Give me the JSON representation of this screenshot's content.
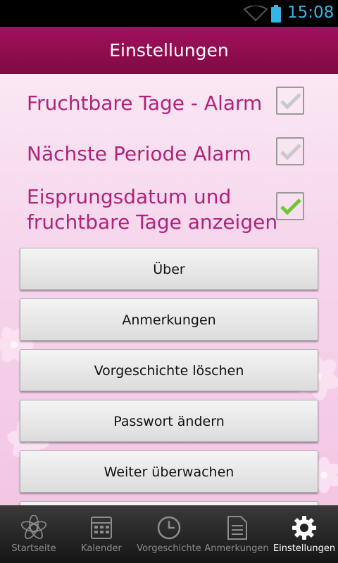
{
  "status_bar": {
    "time": "15:08"
  },
  "header": {
    "title": "Einstellungen"
  },
  "settings": [
    {
      "label": "Fruchtbare Tage - Alarm",
      "checked": false
    },
    {
      "label": "Nächste Periode Alarm",
      "checked": false
    },
    {
      "label": "Eisprungsdatum und fruchtbare Tage anzeigen",
      "checked": true
    }
  ],
  "buttons": {
    "about": "Über",
    "notes": "Anmerkungen",
    "clear_history": "Vorgeschichte löschen",
    "change_password": "Passwort ändern",
    "continue_monitoring": "Weiter überwachen"
  },
  "tabs": [
    {
      "label": "Startseite",
      "icon": "flower-icon"
    },
    {
      "label": "Kalender",
      "icon": "calendar-icon"
    },
    {
      "label": "Vorgeschichte",
      "icon": "clock-icon"
    },
    {
      "label": "Anmerkungen",
      "icon": "notes-icon"
    },
    {
      "label": "Einstellungen",
      "icon": "gear-icon",
      "active": true
    }
  ],
  "colors": {
    "accent": "#a3105d",
    "label_text": "#b1237a",
    "check_green": "#6cc72e",
    "status_blue": "#33b5e5"
  }
}
